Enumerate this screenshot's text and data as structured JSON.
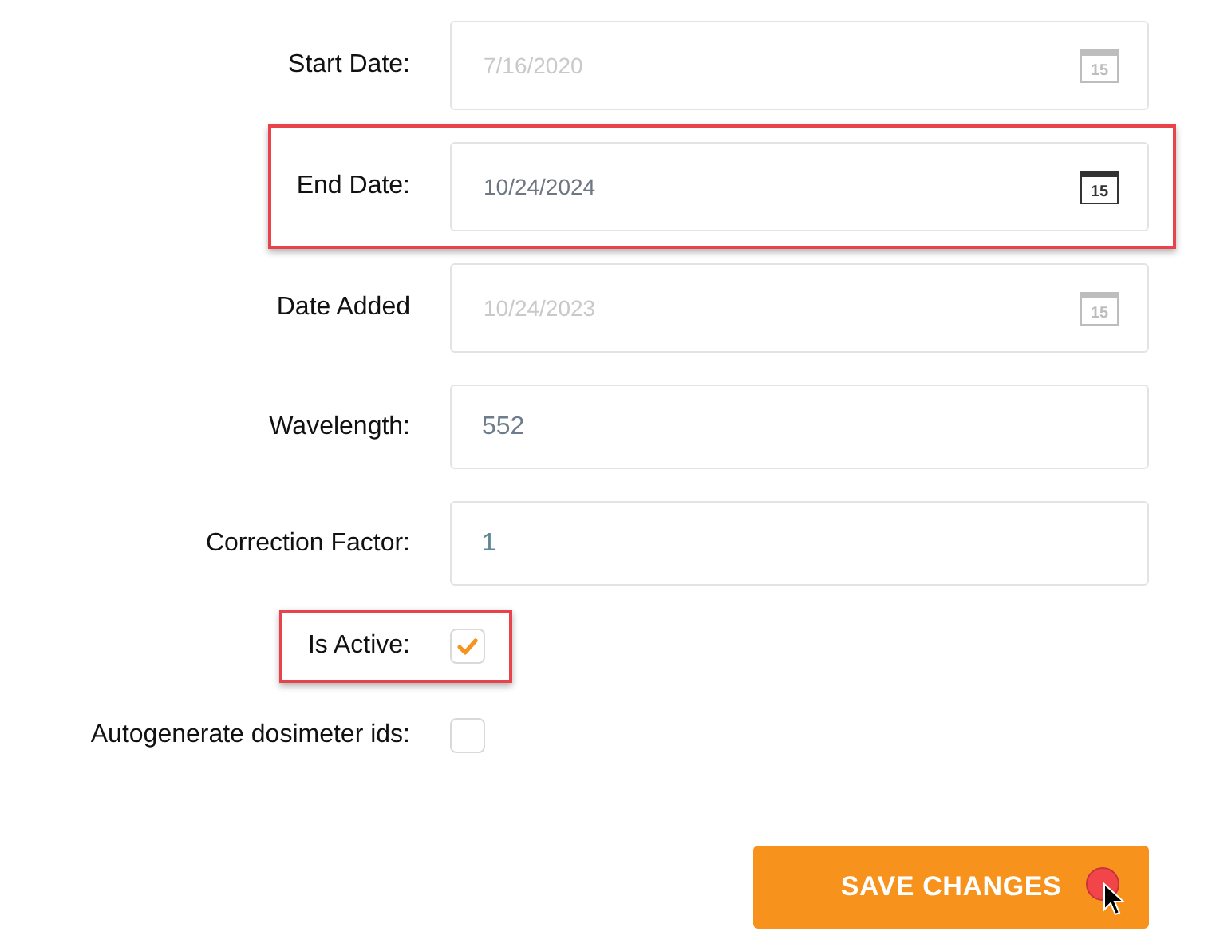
{
  "fields": [
    {
      "kind": "date",
      "label": "Start Date:",
      "value": "7/16/2020",
      "icon_label": "15",
      "disabled": true,
      "highlighted": false
    },
    {
      "kind": "date",
      "label": "End Date:",
      "value": "10/24/2024",
      "icon_label": "15",
      "disabled": false,
      "highlighted": true
    },
    {
      "kind": "date",
      "label": "Date Added",
      "value": "10/24/2023",
      "icon_label": "15",
      "disabled": true,
      "highlighted": false
    },
    {
      "kind": "number",
      "label": "Wavelength:",
      "value": "552",
      "highlighted": false
    },
    {
      "kind": "number",
      "label": "Correction Factor:",
      "value": "1",
      "highlighted": false
    },
    {
      "kind": "checkbox",
      "label": "Is Active:",
      "checked": true,
      "highlighted": true
    },
    {
      "kind": "checkbox",
      "label": "Autogenerate dosimeter ids:",
      "checked": false,
      "highlighted": false
    }
  ],
  "save_button": {
    "label": "SAVE CHANGES"
  }
}
